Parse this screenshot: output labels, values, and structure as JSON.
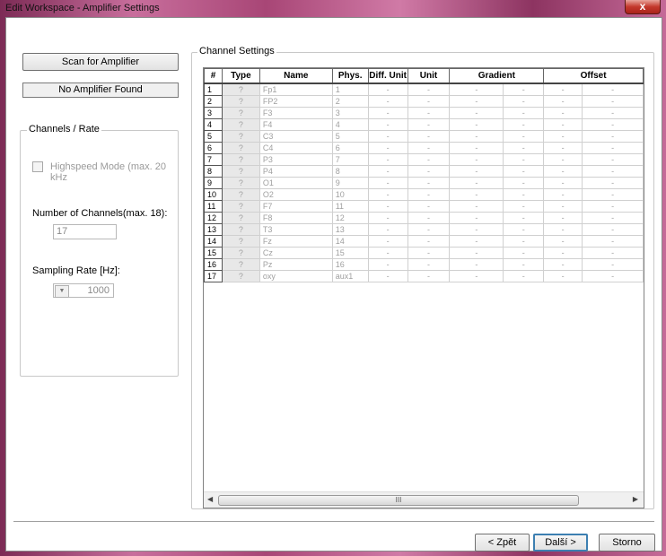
{
  "window": {
    "title": "Edit Workspace - Amplifier Settings",
    "close_glyph": "x"
  },
  "left": {
    "scan_button": "Scan for Amplifier",
    "status": "No Amplifier Found",
    "group_title": "Channels / Rate",
    "highspeed_label": "Highspeed Mode (max. 20 kHz",
    "channels_label": "Number of Channels(max. 18):",
    "channels_value": "17",
    "rate_label": "Sampling Rate [Hz]:",
    "rate_value": "1000"
  },
  "channel_settings": {
    "title": "Channel Settings",
    "columns": [
      "#",
      "Type",
      "Name",
      "Phys.",
      "Diff. Unit",
      "Unit",
      "Gradient",
      "Offset"
    ],
    "scroll_grip": "III",
    "rows": [
      {
        "n": "1",
        "type": "?",
        "name": "Fp1",
        "phys": "1"
      },
      {
        "n": "2",
        "type": "?",
        "name": "FP2",
        "phys": "2"
      },
      {
        "n": "3",
        "type": "?",
        "name": "F3",
        "phys": "3"
      },
      {
        "n": "4",
        "type": "?",
        "name": "F4",
        "phys": "4"
      },
      {
        "n": "5",
        "type": "?",
        "name": "C3",
        "phys": "5"
      },
      {
        "n": "6",
        "type": "?",
        "name": "C4",
        "phys": "6"
      },
      {
        "n": "7",
        "type": "?",
        "name": "P3",
        "phys": "7"
      },
      {
        "n": "8",
        "type": "?",
        "name": "P4",
        "phys": "8"
      },
      {
        "n": "9",
        "type": "?",
        "name": "O1",
        "phys": "9"
      },
      {
        "n": "10",
        "type": "?",
        "name": "O2",
        "phys": "10"
      },
      {
        "n": "11",
        "type": "?",
        "name": "F7",
        "phys": "11"
      },
      {
        "n": "12",
        "type": "?",
        "name": "F8",
        "phys": "12"
      },
      {
        "n": "13",
        "type": "?",
        "name": "T3",
        "phys": "13"
      },
      {
        "n": "14",
        "type": "?",
        "name": "Fz",
        "phys": "14"
      },
      {
        "n": "15",
        "type": "?",
        "name": "Cz",
        "phys": "15"
      },
      {
        "n": "16",
        "type": "?",
        "name": "Pz",
        "phys": "16"
      },
      {
        "n": "17",
        "type": "?",
        "name": "oxy",
        "phys": "aux1"
      }
    ],
    "empty_cell": "-"
  },
  "footer": {
    "back": "< Zpět",
    "next": "Další >",
    "cancel": "Storno"
  }
}
